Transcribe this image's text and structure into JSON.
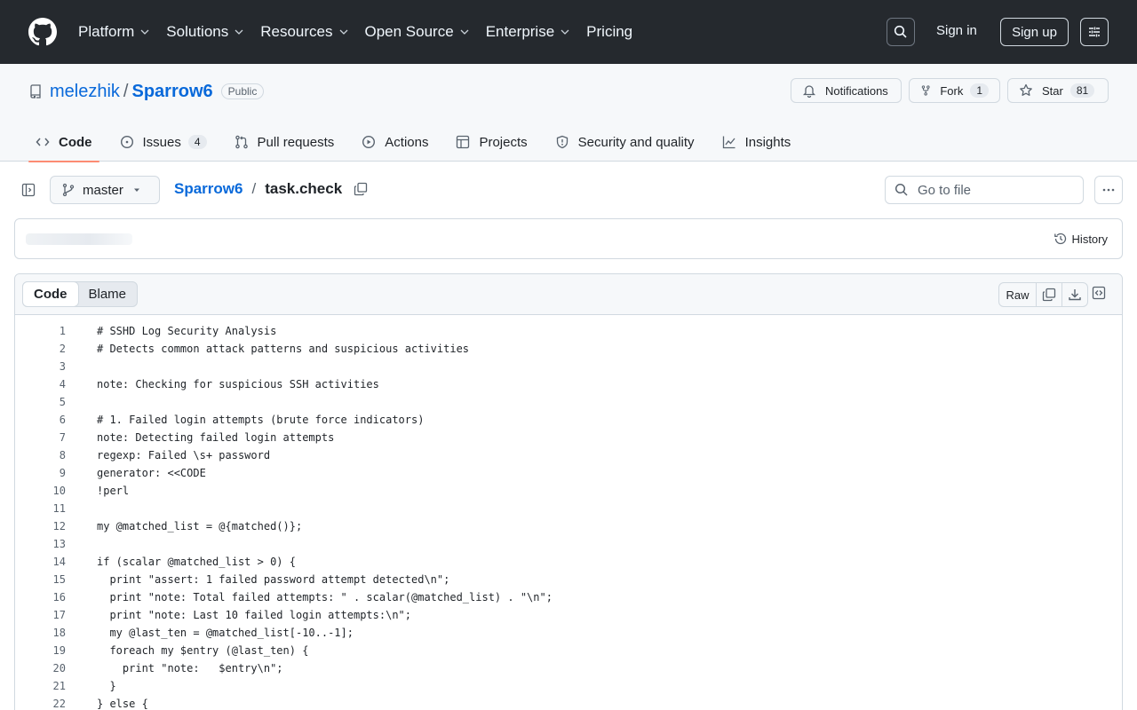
{
  "topnav": {
    "items": [
      {
        "label": "Platform",
        "dropdown": true
      },
      {
        "label": "Solutions",
        "dropdown": true
      },
      {
        "label": "Resources",
        "dropdown": true
      },
      {
        "label": "Open Source",
        "dropdown": true
      },
      {
        "label": "Enterprise",
        "dropdown": true
      },
      {
        "label": "Pricing",
        "dropdown": false
      }
    ],
    "sign_in": "Sign in",
    "sign_up": "Sign up"
  },
  "repo": {
    "owner": "melezhik",
    "separator": "/",
    "name": "Sparrow6",
    "visibility": "Public",
    "notifications_label": "Notifications",
    "fork_label": "Fork",
    "fork_count": "1",
    "star_label": "Star",
    "star_count": "81"
  },
  "tabs": [
    {
      "label": "Code",
      "icon": "code-icon",
      "active": true
    },
    {
      "label": "Issues",
      "icon": "issue-opened-icon",
      "count": "4"
    },
    {
      "label": "Pull requests",
      "icon": "git-pull-request-icon"
    },
    {
      "label": "Actions",
      "icon": "play-icon"
    },
    {
      "label": "Projects",
      "icon": "table-icon"
    },
    {
      "label": "Security and quality",
      "icon": "shield-icon"
    },
    {
      "label": "Insights",
      "icon": "graph-icon"
    }
  ],
  "filebar": {
    "branch": "master",
    "crumb_repo": "Sparrow6",
    "crumb_sep": "/",
    "crumb_file": "task.check",
    "goto_placeholder": "Go to file"
  },
  "commit": {
    "history_label": "History"
  },
  "viewer": {
    "mode_code": "Code",
    "mode_blame": "Blame",
    "raw_label": "Raw"
  },
  "code_lines": [
    "# SSHD Log Security Analysis",
    "# Detects common attack patterns and suspicious activities",
    "",
    "note: Checking for suspicious SSH activities",
    "",
    "# 1. Failed login attempts (brute force indicators)",
    "note: Detecting failed login attempts",
    "regexp: Failed \\s+ password",
    "generator: <<CODE",
    "!perl",
    "",
    "my @matched_list = @{matched()};",
    "",
    "if (scalar @matched_list > 0) {",
    "  print \"assert: 1 failed password attempt detected\\n\";",
    "  print \"note: Total failed attempts: \" . scalar(@matched_list) . \"\\n\";",
    "  print \"note: Last 10 failed login attempts:\\n\";",
    "  my @last_ten = @matched_list[-10..-1];",
    "  foreach my $entry (@last_ten) {",
    "    print \"note:   $entry\\n\";",
    "  }",
    "} else {"
  ],
  "colors": {
    "header_bg": "#25292e",
    "link": "#0969da",
    "active_tab_underline": "#fd8c73"
  }
}
